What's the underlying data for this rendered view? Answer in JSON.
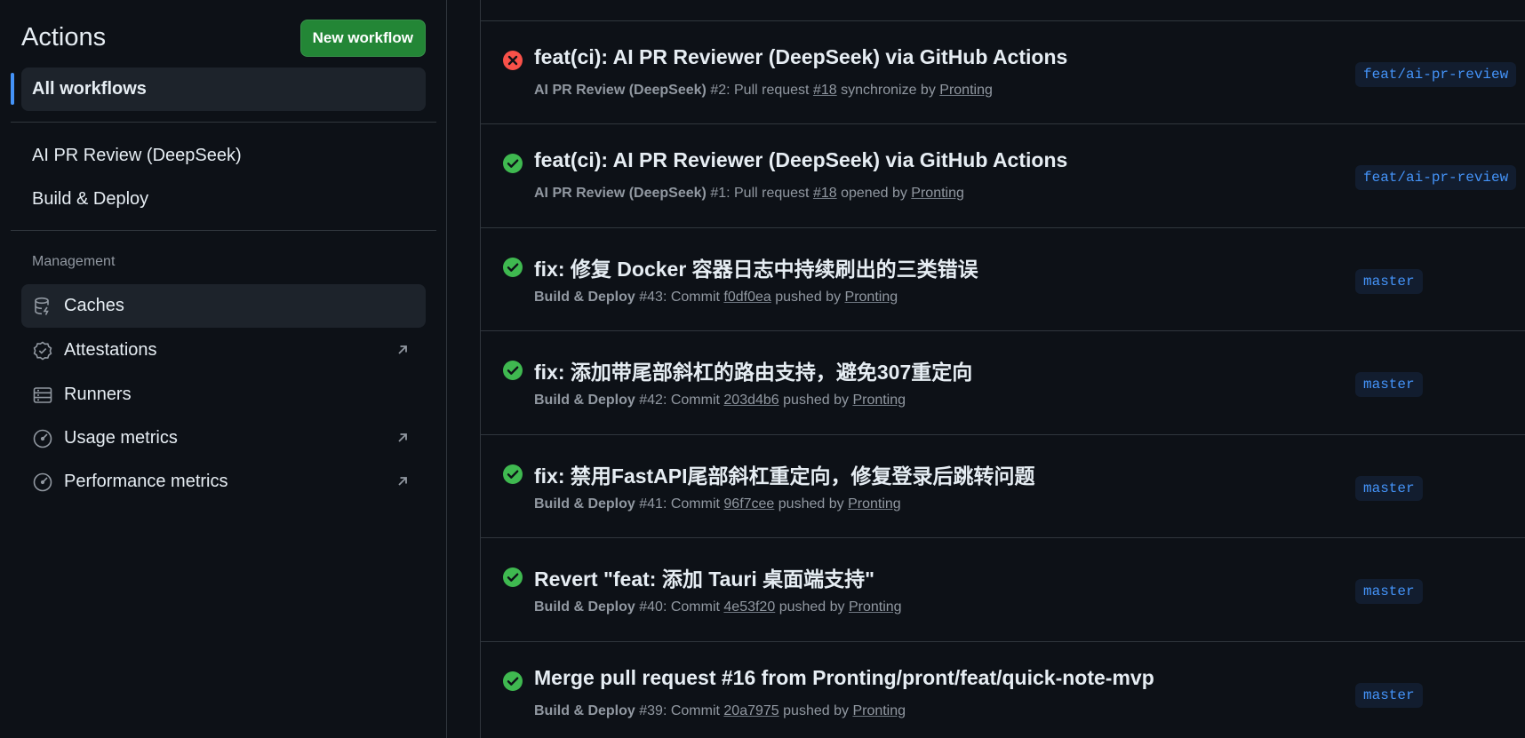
{
  "sidebar": {
    "title": "Actions",
    "new_workflow_label": "New workflow",
    "all_workflows_label": "All workflows",
    "workflows": [
      {
        "label": "AI PR Review (DeepSeek)"
      },
      {
        "label": "Build & Deploy"
      }
    ],
    "management_label": "Management",
    "management_items": [
      {
        "label": "Caches",
        "icon": "database-icon",
        "external": false
      },
      {
        "label": "Attestations",
        "icon": "verified-badge-icon",
        "external": true
      },
      {
        "label": "Runners",
        "icon": "server-icon",
        "external": false
      },
      {
        "label": "Usage metrics",
        "icon": "meter-icon",
        "external": true
      },
      {
        "label": "Performance metrics",
        "icon": "meter-icon",
        "external": true
      }
    ]
  },
  "runs": [
    {
      "status": "failure",
      "title": "feat(ci): AI PR Reviewer (DeepSeek) via GitHub Actions",
      "workflow": "AI PR Review (DeepSeek)",
      "run_number": "#2",
      "event": "Pull request",
      "ref": "#18",
      "action": "synchronize by",
      "actor": "Pronting",
      "branch": "feat/ai-pr-review"
    },
    {
      "status": "success",
      "title": "feat(ci): AI PR Reviewer (DeepSeek) via GitHub Actions",
      "workflow": "AI PR Review (DeepSeek)",
      "run_number": "#1",
      "event": "Pull request",
      "ref": "#18",
      "action": "opened by",
      "actor": "Pronting",
      "branch": "feat/ai-pr-review"
    },
    {
      "status": "success",
      "title": "fix: 修复 Docker 容器日志中持续刷出的三类错误",
      "workflow": "Build & Deploy",
      "run_number": "#43",
      "event": "Commit",
      "ref": "f0df0ea",
      "action": "pushed by",
      "actor": "Pronting",
      "branch": "master"
    },
    {
      "status": "success",
      "title": "fix: 添加带尾部斜杠的路由支持，避免307重定向",
      "workflow": "Build & Deploy",
      "run_number": "#42",
      "event": "Commit",
      "ref": "203d4b6",
      "action": "pushed by",
      "actor": "Pronting",
      "branch": "master"
    },
    {
      "status": "success",
      "title": "fix: 禁用FastAPI尾部斜杠重定向，修复登录后跳转问题",
      "workflow": "Build & Deploy",
      "run_number": "#41",
      "event": "Commit",
      "ref": "96f7cee",
      "action": "pushed by",
      "actor": "Pronting",
      "branch": "master"
    },
    {
      "status": "success",
      "title": "Revert \"feat: 添加 Tauri 桌面端支持\"",
      "workflow": "Build & Deploy",
      "run_number": "#40",
      "event": "Commit",
      "ref": "4e53f20",
      "action": "pushed by",
      "actor": "Pronting",
      "branch": "master"
    },
    {
      "status": "success",
      "title": "Merge pull request #16 from Pronting/pront/feat/quick-note-mvp",
      "workflow": "Build & Deploy",
      "run_number": "#39",
      "event": "Commit",
      "ref": "20a7975",
      "action": "pushed by",
      "actor": "Pronting",
      "branch": "master"
    }
  ],
  "colors": {
    "background": "#0d1117",
    "accent": "#4493f8",
    "success": "#3fb950",
    "failure": "#f85149",
    "button": "#238636"
  }
}
